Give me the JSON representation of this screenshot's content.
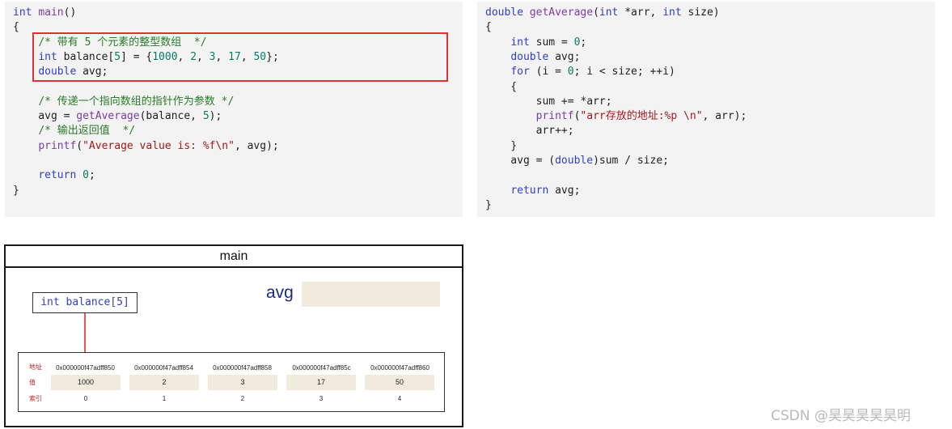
{
  "code_left": [
    [
      {
        "t": "int",
        "c": "kw"
      },
      {
        "t": " "
      },
      {
        "t": "main",
        "c": "fn"
      },
      {
        "t": "()"
      }
    ],
    [
      {
        "t": "{"
      }
    ],
    [
      {
        "t": "    "
      },
      {
        "t": "/* 带有 5 个元素的整型数组  */",
        "c": "cm"
      }
    ],
    [
      {
        "t": "    "
      },
      {
        "t": "int",
        "c": "kw"
      },
      {
        "t": " balance["
      },
      {
        "t": "5",
        "c": "num"
      },
      {
        "t": "] = {"
      },
      {
        "t": "1000",
        "c": "num"
      },
      {
        "t": ", "
      },
      {
        "t": "2",
        "c": "num"
      },
      {
        "t": ", "
      },
      {
        "t": "3",
        "c": "num"
      },
      {
        "t": ", "
      },
      {
        "t": "17",
        "c": "num"
      },
      {
        "t": ", "
      },
      {
        "t": "50",
        "c": "num"
      },
      {
        "t": "};"
      }
    ],
    [
      {
        "t": "    "
      },
      {
        "t": "double",
        "c": "kw"
      },
      {
        "t": " avg;"
      }
    ],
    [
      {
        "t": ""
      }
    ],
    [
      {
        "t": "    "
      },
      {
        "t": "/* 传递一个指向数组的指针作为参数 */",
        "c": "cm"
      }
    ],
    [
      {
        "t": "    avg = "
      },
      {
        "t": "getAverage",
        "c": "fn"
      },
      {
        "t": "(balance, "
      },
      {
        "t": "5",
        "c": "num"
      },
      {
        "t": ");"
      }
    ],
    [
      {
        "t": "    "
      },
      {
        "t": "/* 输出返回值  */",
        "c": "cm"
      }
    ],
    [
      {
        "t": "    "
      },
      {
        "t": "printf",
        "c": "fn"
      },
      {
        "t": "("
      },
      {
        "t": "\"Average value is: %f\\n\"",
        "c": "str"
      },
      {
        "t": ", avg);"
      }
    ],
    [
      {
        "t": ""
      }
    ],
    [
      {
        "t": "    "
      },
      {
        "t": "return",
        "c": "kw"
      },
      {
        "t": " "
      },
      {
        "t": "0",
        "c": "num"
      },
      {
        "t": ";"
      }
    ],
    [
      {
        "t": "}"
      }
    ]
  ],
  "code_right": [
    [
      {
        "t": "double",
        "c": "kw"
      },
      {
        "t": " "
      },
      {
        "t": "getAverage",
        "c": "fn"
      },
      {
        "t": "("
      },
      {
        "t": "int",
        "c": "kw"
      },
      {
        "t": " *arr, "
      },
      {
        "t": "int",
        "c": "kw"
      },
      {
        "t": " size)"
      }
    ],
    [
      {
        "t": "{"
      }
    ],
    [
      {
        "t": "    "
      },
      {
        "t": "int",
        "c": "kw"
      },
      {
        "t": " sum = "
      },
      {
        "t": "0",
        "c": "num"
      },
      {
        "t": ";"
      }
    ],
    [
      {
        "t": "    "
      },
      {
        "t": "double",
        "c": "kw"
      },
      {
        "t": " avg;"
      }
    ],
    [
      {
        "t": "    "
      },
      {
        "t": "for",
        "c": "kw"
      },
      {
        "t": " (i = "
      },
      {
        "t": "0",
        "c": "num"
      },
      {
        "t": "; i < size; ++i)"
      }
    ],
    [
      {
        "t": "    {"
      }
    ],
    [
      {
        "t": "        sum += *arr;"
      }
    ],
    [
      {
        "t": "        "
      },
      {
        "t": "printf",
        "c": "fn"
      },
      {
        "t": "("
      },
      {
        "t": "\"arr存放的地址:%p \\n\"",
        "c": "str"
      },
      {
        "t": ", arr);"
      }
    ],
    [
      {
        "t": "        arr++;"
      }
    ],
    [
      {
        "t": "    }"
      }
    ],
    [
      {
        "t": "    avg = ("
      },
      {
        "t": "double",
        "c": "kw"
      },
      {
        "t": ")sum / size;"
      }
    ],
    [
      {
        "t": ""
      }
    ],
    [
      {
        "t": "    "
      },
      {
        "t": "return",
        "c": "kw"
      },
      {
        "t": " avg;"
      }
    ],
    [
      {
        "t": "}"
      }
    ]
  ],
  "diagram": {
    "title": "main",
    "var_label": "int balance[5]",
    "avg_label": "avg",
    "row_labels": {
      "addr": "地址",
      "value": "值",
      "index": "索引"
    },
    "cells": [
      {
        "addr": "0x000000f47adff850",
        "value": "1000",
        "index": "0"
      },
      {
        "addr": "0x000000f47adff854",
        "value": "2",
        "index": "1"
      },
      {
        "addr": "0x000000f47adff858",
        "value": "3",
        "index": "2"
      },
      {
        "addr": "0x000000f47adff85c",
        "value": "17",
        "index": "3"
      },
      {
        "addr": "0x000000f47adff860",
        "value": "50",
        "index": "4"
      }
    ]
  },
  "watermark": "CSDN @昊昊昊昊昊明",
  "colors": {
    "highlight": "#e03232",
    "cell_fill": "#f1ebdd",
    "arrow": "#e02020"
  }
}
